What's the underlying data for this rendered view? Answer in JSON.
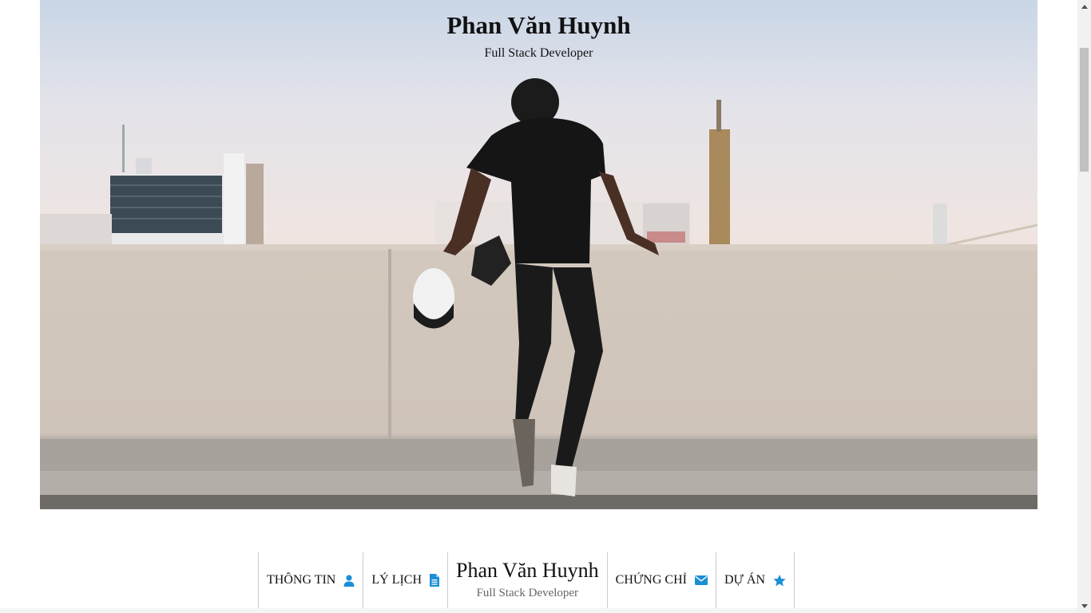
{
  "hero": {
    "title": "Phan Văn Huynh",
    "subtitle": "Full Stack Developer",
    "image": "person-on-rooftop-photo"
  },
  "nav": {
    "items_left": [
      {
        "label": "THÔNG TIN",
        "icon": "user-icon"
      },
      {
        "label": "LÝ LỊCH",
        "icon": "document-icon"
      }
    ],
    "brand": {
      "name": "Phan Văn Huynh",
      "role": "Full Stack Developer"
    },
    "items_right": [
      {
        "label": "CHỨNG CHỈ",
        "icon": "envelope-icon"
      },
      {
        "label": "DỰ ÁN",
        "icon": "star-icon"
      }
    ]
  },
  "colors": {
    "accent": "#1b8fd6",
    "text": "#111111",
    "muted": "#666666"
  }
}
